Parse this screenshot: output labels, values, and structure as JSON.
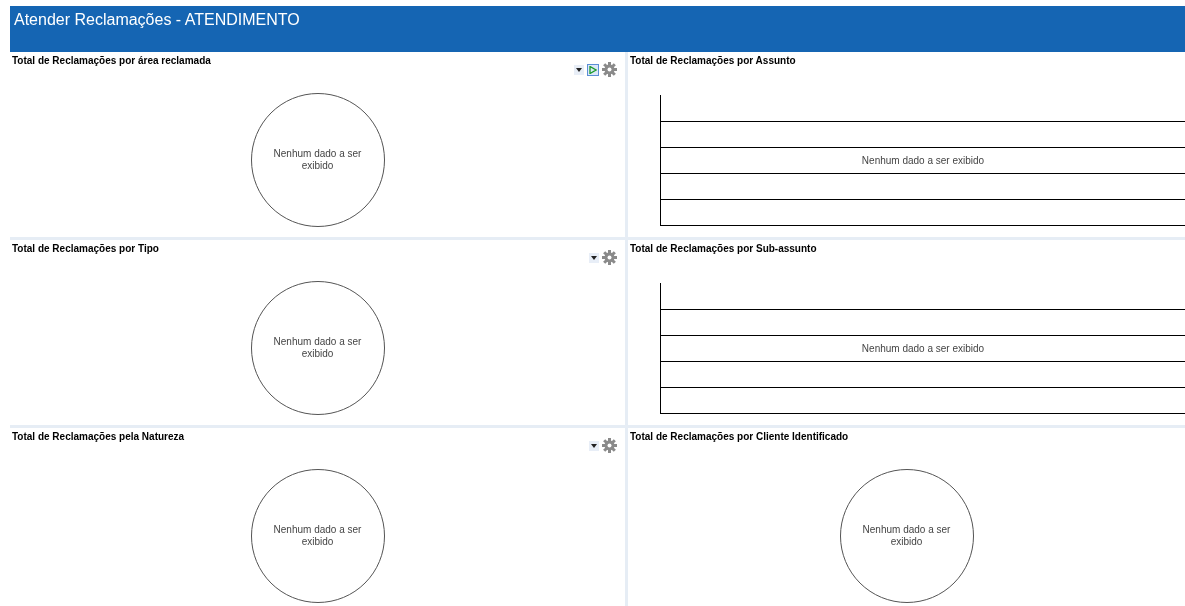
{
  "header": {
    "title": "Atender Reclamações - ATENDIMENTO"
  },
  "panels": [
    {
      "title": "Total de Reclamações por área reclamada",
      "kind": "pie",
      "message": "Nenhum dado a ser exibido",
      "tools": [
        {
          "kind": "dropdown"
        },
        {
          "kind": "play"
        },
        {
          "kind": "gear"
        }
      ]
    },
    {
      "title": "Total de Reclamações por Assunto",
      "kind": "grid",
      "message": "Nenhum dado a ser exibido"
    },
    {
      "title": "Total de Reclamações por Tipo",
      "kind": "pie",
      "message": "Nenhum dado a ser exibido",
      "tools": [
        {
          "kind": "dropdown"
        },
        {
          "kind": "gear"
        }
      ]
    },
    {
      "title": "Total de Reclamações por Sub-assunto",
      "kind": "grid",
      "message": "Nenhum dado a ser exibido"
    },
    {
      "title": "Total de Reclamações pela Natureza",
      "kind": "pie",
      "message": "Nenhum dado a ser exibido",
      "tools": [
        {
          "kind": "dropdown"
        },
        {
          "kind": "gear"
        }
      ]
    },
    {
      "title": "Total de Reclamações por Cliente Identificado",
      "kind": "pie",
      "message": "Nenhum dado a ser exibido"
    }
  ]
}
